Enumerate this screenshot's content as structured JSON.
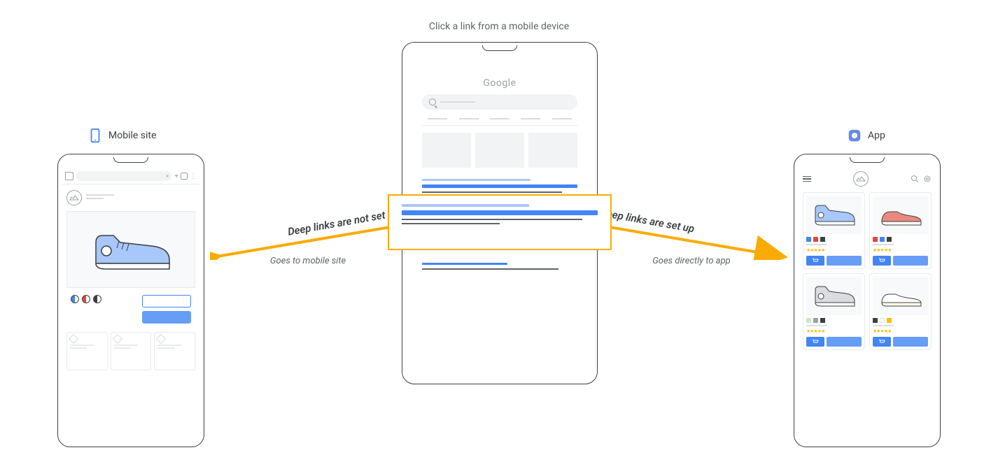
{
  "title": "Click a link from a mobile device",
  "left": {
    "label": "Mobile site",
    "arrow_top": "Deep links are not set up",
    "arrow_bottom": "Goes to mobile site"
  },
  "right": {
    "label": "App",
    "arrow_top": "Deep links are set up",
    "arrow_bottom": "Goes directly to app"
  },
  "center": {
    "logo": "Google"
  },
  "colors": {
    "blue": "#4285f4",
    "light_blue": "#a8c7fa",
    "yellow": "#f9ab00",
    "red": "#ea8a7f",
    "gray": "#9aa0a6"
  }
}
